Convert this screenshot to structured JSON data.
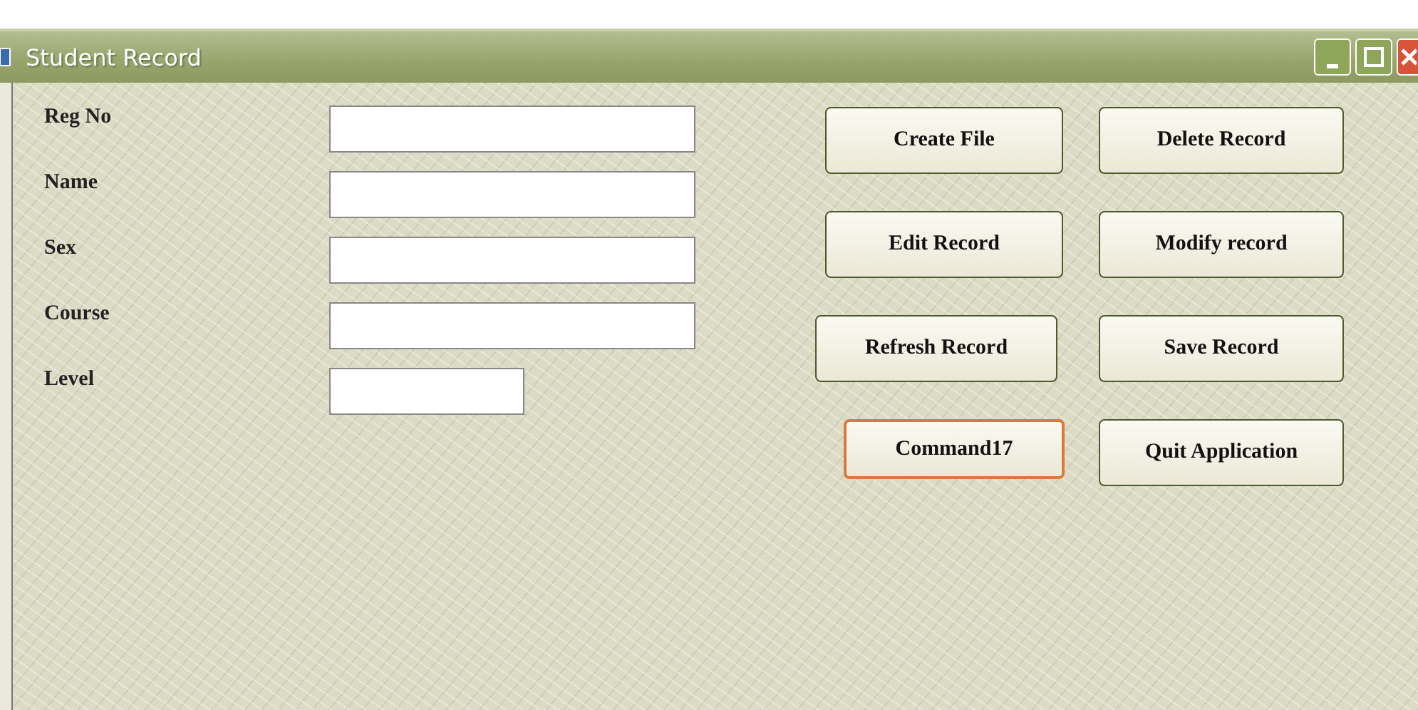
{
  "window": {
    "title": "Student Record"
  },
  "fields": [
    {
      "label": "Reg No",
      "kind": "wide"
    },
    {
      "label": "Name",
      "kind": "wide"
    },
    {
      "label": "Sex",
      "kind": "wide"
    },
    {
      "label": "Course",
      "kind": "wide"
    },
    {
      "label": "Level",
      "kind": "narrow"
    }
  ],
  "buttons": [
    {
      "label": "Create File",
      "focused": false
    },
    {
      "label": "Delete Record",
      "focused": false
    },
    {
      "label": "Edit Record",
      "focused": false
    },
    {
      "label": "Modify record",
      "focused": false
    },
    {
      "label": "Refresh Record",
      "focused": false
    },
    {
      "label": "Save Record",
      "focused": false
    },
    {
      "label": "Command17",
      "focused": true
    },
    {
      "label": "Quit Application",
      "focused": false
    }
  ]
}
